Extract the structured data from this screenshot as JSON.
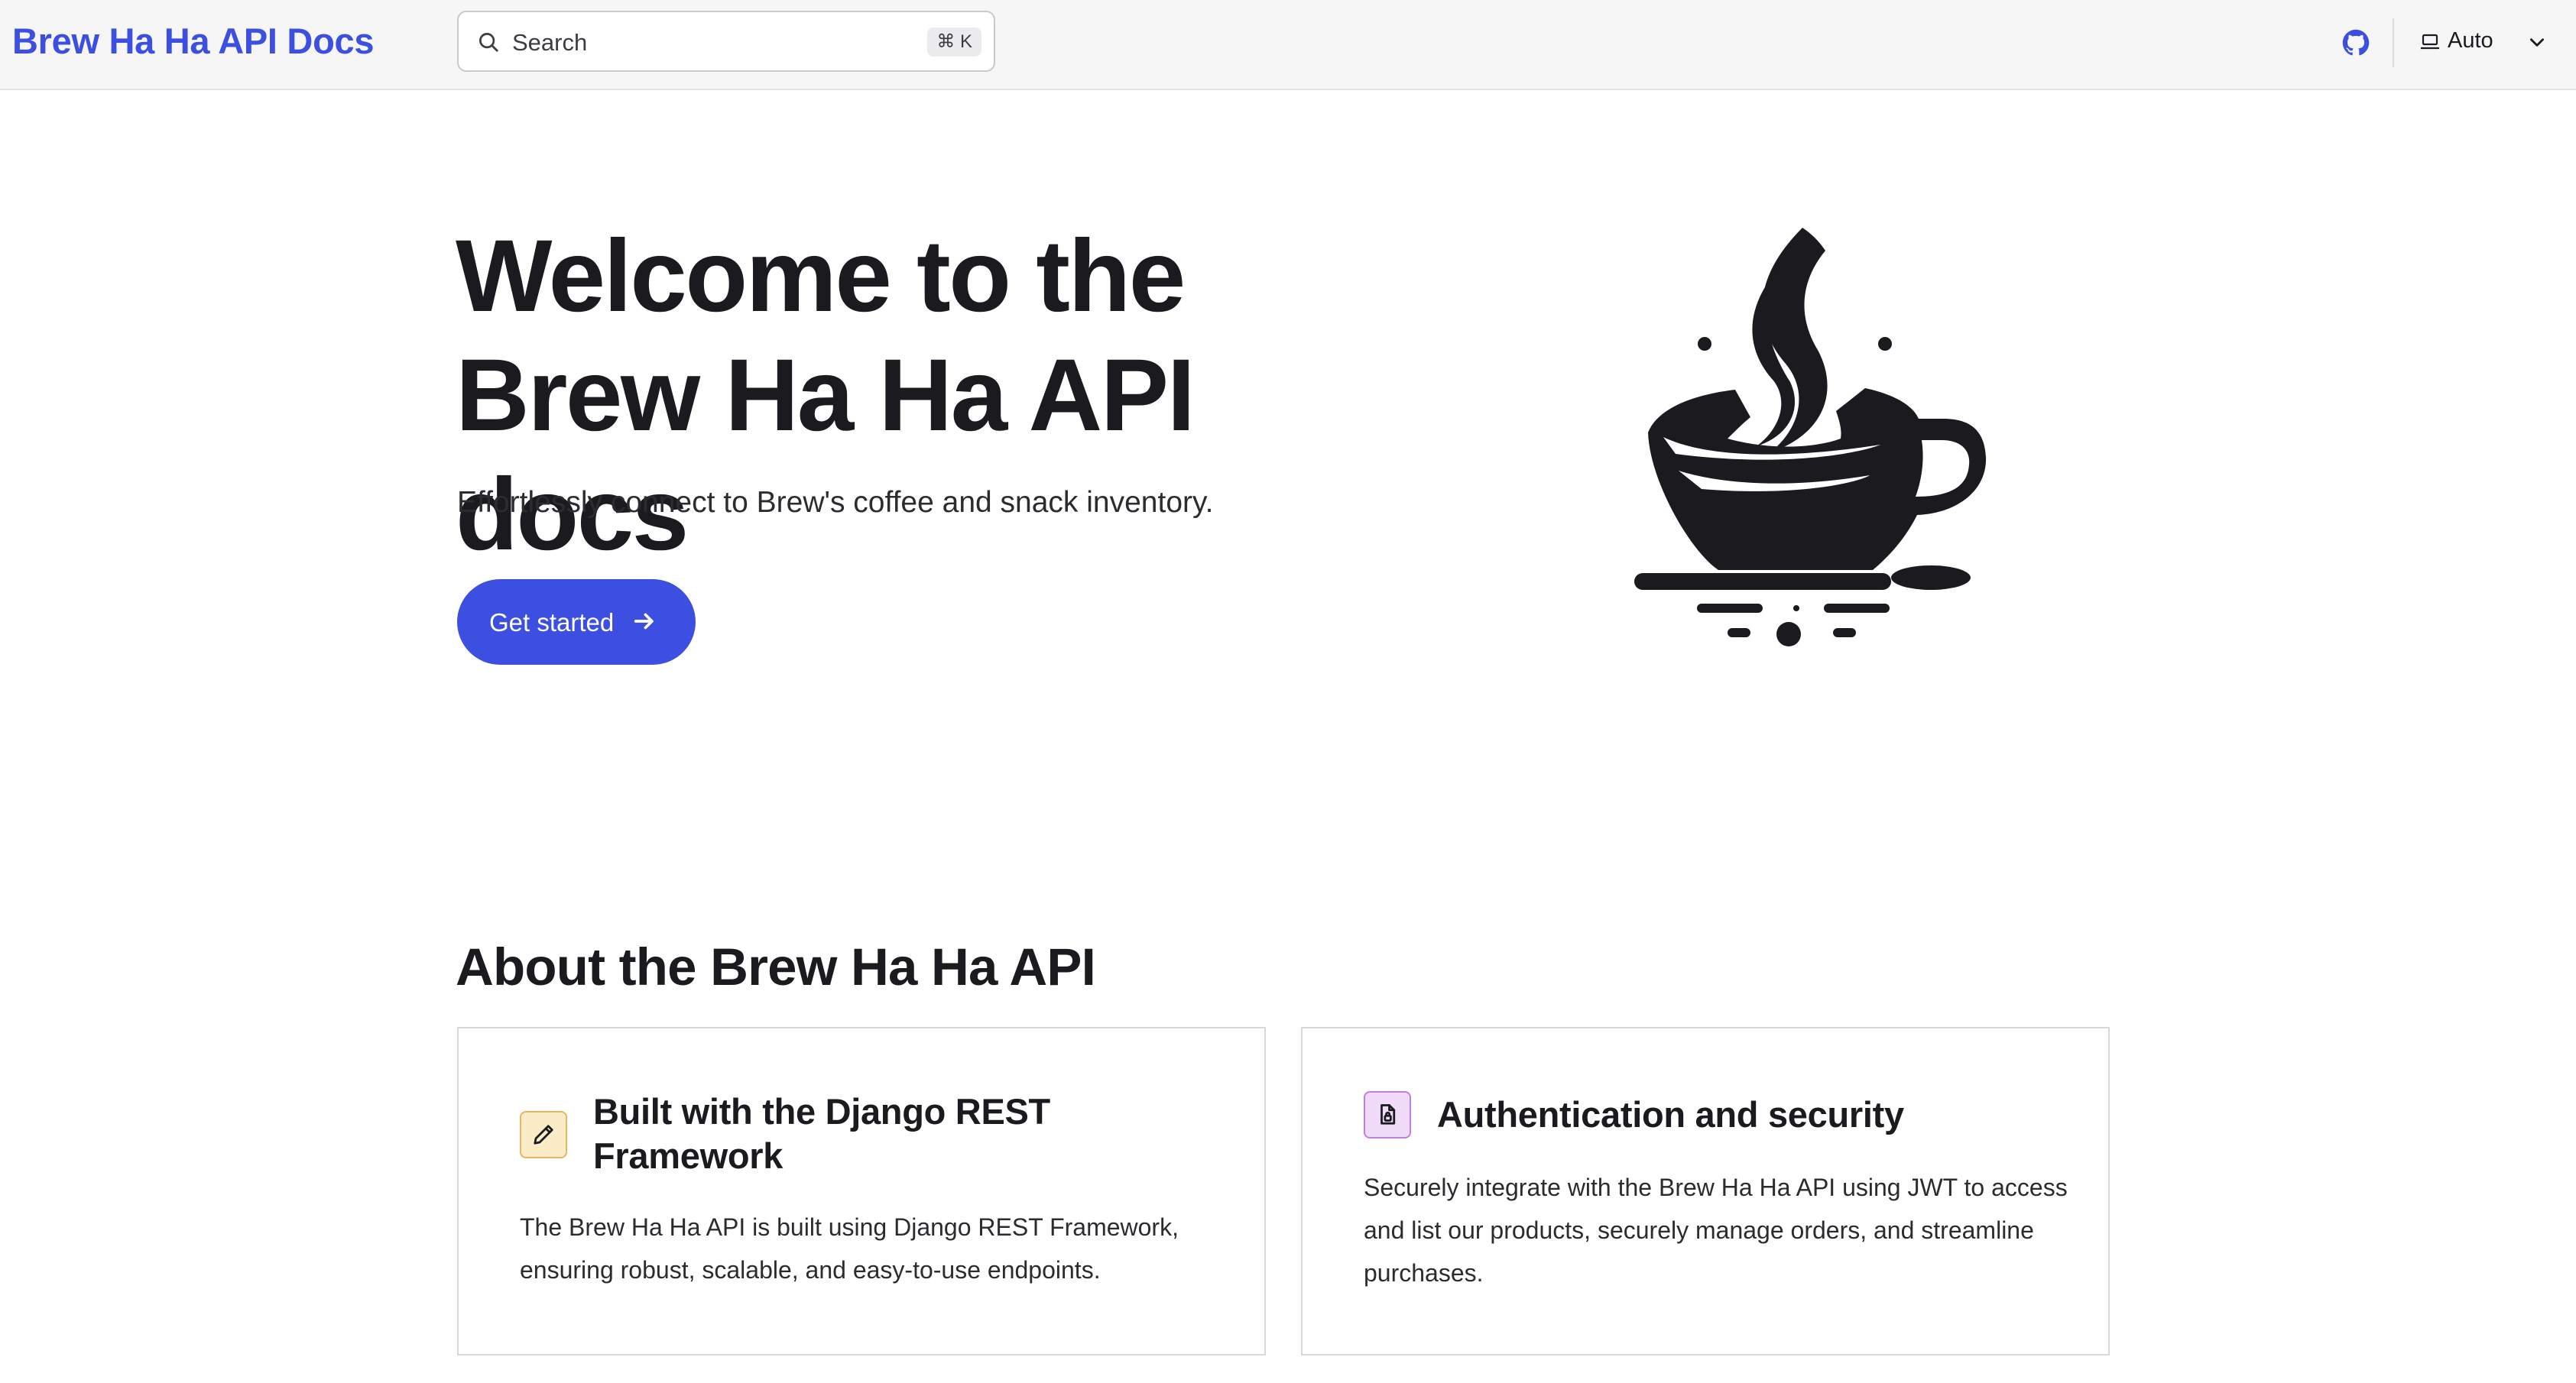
{
  "header": {
    "brand": "Brew Ha Ha API Docs",
    "search": {
      "placeholder": "Search",
      "shortcut": "⌘ K"
    },
    "github_icon": "github-icon",
    "theme": {
      "icon": "laptop-icon",
      "label": "Auto",
      "chevron": "chevron-down-icon"
    }
  },
  "hero": {
    "title": "Welcome to the Brew Ha Ha API docs",
    "subtitle": "Effortlessly connect to Brew's coffee and snack inventory.",
    "cta_label": "Get started",
    "cta_icon": "arrow-right-icon",
    "logo": "coffee-cup-logo"
  },
  "about": {
    "title": "About the Brew Ha Ha API",
    "cards": [
      {
        "icon": "pencil-icon",
        "title": "Built with the Django REST Framework",
        "body": "The Brew Ha Ha API is built using Django REST Framework, ensuring robust, scalable, and easy-to-use endpoints."
      },
      {
        "icon": "secure-file-icon",
        "title": "Authentication and security",
        "body": "Securely integrate with the Brew Ha Ha API using JWT to access and list our products, securely manage orders, and streamline purchases."
      }
    ]
  },
  "colors": {
    "accent": "#3c4fe0",
    "header_bg": "#f6f6f7",
    "text": "#1b1b1f",
    "badge_amber": "#fbecc8",
    "badge_purple": "#f0dbf8"
  }
}
